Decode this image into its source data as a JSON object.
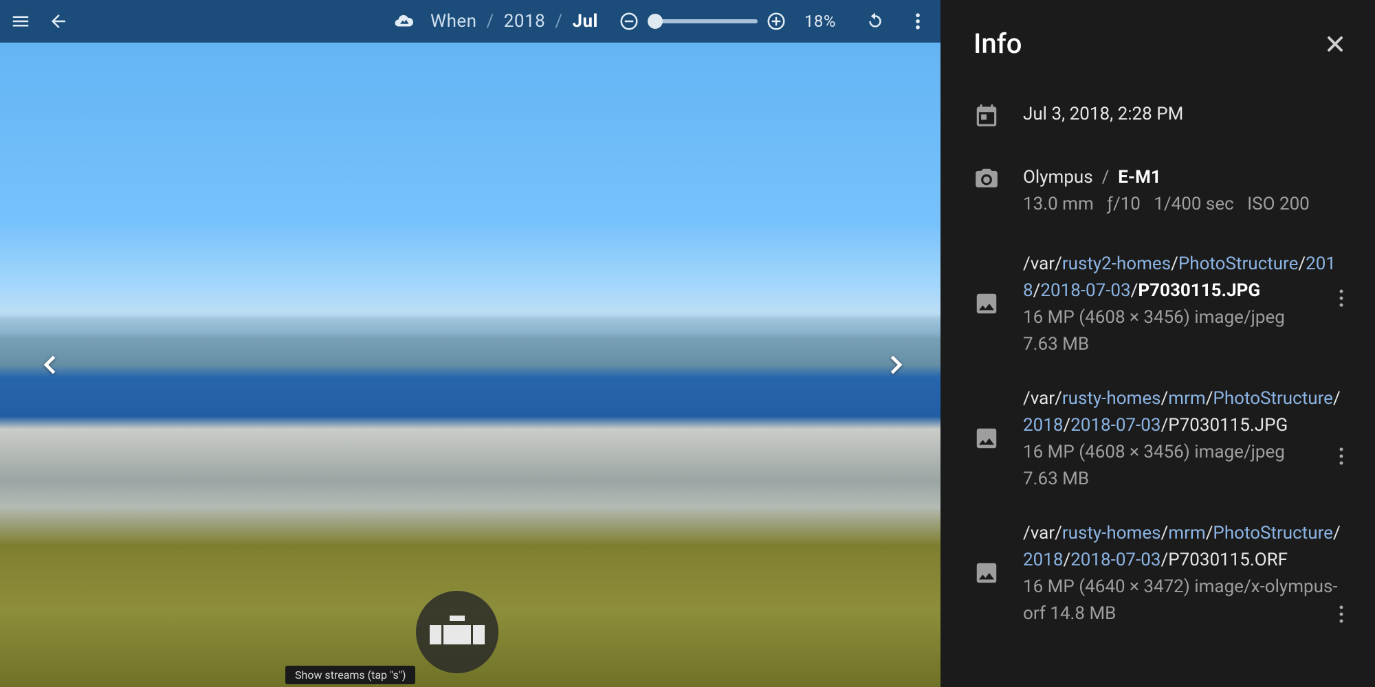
{
  "header": {
    "breadcrumb": [
      "When",
      "2018",
      "Jul"
    ],
    "sep": "/",
    "zoom_pct": "18%"
  },
  "tooltip": "Show streams   (tap \"s\")",
  "info": {
    "title": "Info",
    "date": "Jul 3, 2018, 2:28 PM",
    "camera_make": "Olympus",
    "camera_sep": "/",
    "camera_model": "E-M1",
    "focal": "13.0 mm",
    "aperture": "ƒ/10",
    "shutter": "1/400 sec",
    "iso": "ISO 200",
    "files": [
      {
        "path": [
          {
            "t": "/var/",
            "l": false
          },
          {
            "t": "rusty2-homes",
            "l": true
          },
          {
            "t": "/",
            "l": false
          },
          {
            "t": "PhotoStructure",
            "l": true
          },
          {
            "t": "/",
            "l": false
          },
          {
            "t": "2018",
            "l": true
          },
          {
            "t": "/",
            "l": false
          },
          {
            "t": "2018-07-03",
            "l": true
          },
          {
            "t": "/",
            "l": false
          },
          {
            "t": "P7030115.JPG",
            "l": false,
            "b": true
          }
        ],
        "meta1": "16 MP (4608 × 3456) image/jpeg",
        "meta2": "7.63 MB"
      },
      {
        "path": [
          {
            "t": "/var/",
            "l": false
          },
          {
            "t": "rusty-homes",
            "l": true
          },
          {
            "t": "/",
            "l": false
          },
          {
            "t": "mrm",
            "l": true
          },
          {
            "t": "/",
            "l": false
          },
          {
            "t": "PhotoStructure",
            "l": true
          },
          {
            "t": "/",
            "l": false
          },
          {
            "t": "2018",
            "l": true
          },
          {
            "t": "/",
            "l": false
          },
          {
            "t": "2018-07-03",
            "l": true
          },
          {
            "t": "/",
            "l": false
          },
          {
            "t": "P7030115.JPG",
            "l": false,
            "b": false
          }
        ],
        "meta1": "16 MP (4608 × 3456) image/jpeg",
        "meta2": "7.63 MB"
      },
      {
        "path": [
          {
            "t": "/var/",
            "l": false
          },
          {
            "t": "rusty-homes",
            "l": true
          },
          {
            "t": "/",
            "l": false
          },
          {
            "t": "mrm",
            "l": true
          },
          {
            "t": "/",
            "l": false
          },
          {
            "t": "PhotoStructure",
            "l": true
          },
          {
            "t": "/",
            "l": false
          },
          {
            "t": "2018",
            "l": true
          },
          {
            "t": "/",
            "l": false
          },
          {
            "t": "2018-07-03",
            "l": true
          },
          {
            "t": "/",
            "l": false
          },
          {
            "t": "P7030115.ORF",
            "l": false,
            "b": false
          }
        ],
        "meta1": "16 MP (4640 × 3472) image/x-olympus-orf 14.8 MB",
        "meta2": ""
      }
    ]
  }
}
